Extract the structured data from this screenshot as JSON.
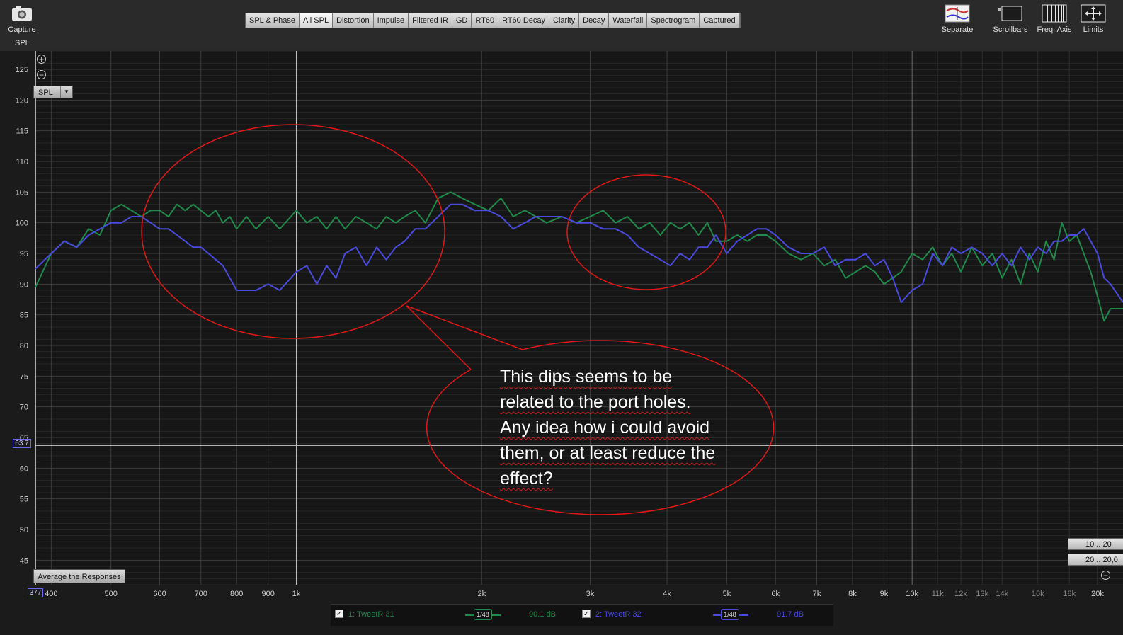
{
  "toolbar": {
    "capture_label": "Capture",
    "tabs": [
      "SPL & Phase",
      "All SPL",
      "Distortion",
      "Impulse",
      "Filtered IR",
      "GD",
      "RT60",
      "RT60 Decay",
      "Clarity",
      "Decay",
      "Waterfall",
      "Spectrogram",
      "Captured"
    ],
    "active_tab": "All SPL",
    "right_tools": [
      "Separate",
      "Scrollbars",
      "Freq. Axis",
      "Limits"
    ]
  },
  "plot": {
    "y_axis_title": "SPL",
    "selector_value": "SPL",
    "average_button_label": "Average the Responses",
    "range_buttons": [
      "10 .. 20",
      "20 .. 20,0"
    ],
    "cursor_y_value": "63.7",
    "cursor_x_value": "377"
  },
  "legend": {
    "trace1": {
      "label": "1: TweetR 31",
      "smoothing": "1/48",
      "level": "90.1 dB"
    },
    "trace2": {
      "label": "2: TweetR 32",
      "smoothing": "1/48",
      "level": "91.7 dB"
    }
  },
  "annotation": {
    "lines": [
      "This dips seems to be",
      "related to the port holes.",
      "Any idea how i could avoid",
      "them, or at least reduce the",
      "effect?"
    ]
  },
  "colors": {
    "trace1": "#1f8a4a",
    "trace2": "#4a4adf",
    "annotation": "#e01818",
    "background": "#1b1b1b"
  },
  "chart_data": {
    "type": "line",
    "title": "",
    "xlabel": "",
    "ylabel": "SPL",
    "x_scale": "log",
    "xlim": [
      377,
      22000
    ],
    "ylim": [
      41,
      128
    ],
    "grid": true,
    "y_ticks": [
      125,
      120,
      115,
      110,
      105,
      100,
      95,
      90,
      85,
      80,
      75,
      70,
      65,
      60,
      55,
      50,
      45
    ],
    "x_ticks": [
      {
        "f": 400,
        "label": "400",
        "major": true
      },
      {
        "f": 500,
        "label": "500",
        "major": true
      },
      {
        "f": 600,
        "label": "600",
        "major": true
      },
      {
        "f": 700,
        "label": "700",
        "major": true
      },
      {
        "f": 800,
        "label": "800",
        "major": true
      },
      {
        "f": 900,
        "label": "900",
        "major": true
      },
      {
        "f": 1000,
        "label": "1k",
        "major": true
      },
      {
        "f": 2000,
        "label": "2k",
        "major": true
      },
      {
        "f": 3000,
        "label": "3k",
        "major": true
      },
      {
        "f": 4000,
        "label": "4k",
        "major": true
      },
      {
        "f": 5000,
        "label": "5k",
        "major": true
      },
      {
        "f": 6000,
        "label": "6k",
        "major": true
      },
      {
        "f": 7000,
        "label": "7k",
        "major": true
      },
      {
        "f": 8000,
        "label": "8k",
        "major": true
      },
      {
        "f": 9000,
        "label": "9k",
        "major": true
      },
      {
        "f": 10000,
        "label": "10k",
        "major": true
      },
      {
        "f": 11000,
        "label": "11k",
        "major": false
      },
      {
        "f": 12000,
        "label": "12k",
        "major": false
      },
      {
        "f": 13000,
        "label": "13k",
        "major": false
      },
      {
        "f": 14000,
        "label": "14k",
        "major": false
      },
      {
        "f": 16000,
        "label": "16k",
        "major": false
      },
      {
        "f": 18000,
        "label": "18k",
        "major": false
      },
      {
        "f": 20000,
        "label": "20k",
        "major": true
      }
    ],
    "series": [
      {
        "name": "1: TweetR 31",
        "color": "#1f8a4a",
        "x": [
          377,
          400,
          420,
          440,
          460,
          480,
          500,
          520,
          540,
          560,
          580,
          600,
          620,
          640,
          660,
          680,
          700,
          720,
          740,
          760,
          780,
          800,
          830,
          860,
          900,
          940,
          980,
          1000,
          1040,
          1080,
          1120,
          1160,
          1200,
          1250,
          1300,
          1350,
          1400,
          1450,
          1500,
          1560,
          1620,
          1700,
          1780,
          1860,
          1950,
          2050,
          2150,
          2250,
          2350,
          2450,
          2550,
          2700,
          2850,
          3000,
          3150,
          3300,
          3450,
          3600,
          3750,
          3900,
          4050,
          4200,
          4350,
          4500,
          4650,
          4800,
          5000,
          5200,
          5400,
          5600,
          5800,
          6000,
          6300,
          6600,
          6900,
          7200,
          7500,
          7800,
          8100,
          8400,
          8700,
          9000,
          9300,
          9600,
          10000,
          10400,
          10800,
          11200,
          11600,
          12000,
          12500,
          13000,
          13500,
          14000,
          14500,
          15000,
          15500,
          16000,
          16500,
          17000,
          17500,
          18000,
          18500,
          19000,
          19500,
          20000,
          20500,
          21000,
          22000
        ],
        "y": [
          89.5,
          95,
          97,
          96,
          99,
          98,
          102,
          103,
          102,
          101,
          102,
          102,
          101,
          103,
          102,
          103,
          102,
          101,
          102,
          100,
          101,
          99,
          101,
          99,
          101,
          99,
          101,
          102,
          100,
          101,
          99,
          101,
          99,
          101,
          100,
          99,
          101,
          100,
          101,
          102,
          100,
          104,
          105,
          104,
          103,
          102,
          104,
          101,
          102,
          101,
          100,
          101,
          100,
          101,
          102,
          100,
          101,
          99,
          100,
          98,
          100,
          99,
          100,
          98,
          100,
          97,
          97,
          98,
          97,
          98,
          98,
          97,
          95,
          94,
          95,
          93,
          94,
          91,
          92,
          93,
          92,
          90,
          91,
          92,
          95,
          94,
          96,
          93,
          95,
          92,
          96,
          93,
          95,
          91,
          94,
          90,
          95,
          92,
          97,
          94,
          100,
          97,
          98,
          95,
          92,
          88,
          84,
          86,
          86
        ]
      },
      {
        "name": "2: TweetR 32",
        "color": "#4a4adf",
        "x": [
          377,
          400,
          420,
          440,
          460,
          480,
          500,
          520,
          540,
          560,
          580,
          600,
          620,
          640,
          660,
          680,
          700,
          720,
          740,
          760,
          780,
          800,
          830,
          860,
          900,
          940,
          980,
          1000,
          1040,
          1080,
          1120,
          1160,
          1200,
          1250,
          1300,
          1350,
          1400,
          1450,
          1500,
          1560,
          1620,
          1700,
          1780,
          1860,
          1950,
          2050,
          2150,
          2250,
          2350,
          2450,
          2550,
          2700,
          2850,
          3000,
          3150,
          3300,
          3450,
          3600,
          3750,
          3900,
          4050,
          4200,
          4350,
          4500,
          4650,
          4800,
          5000,
          5200,
          5400,
          5600,
          5800,
          6000,
          6300,
          6600,
          6900,
          7200,
          7500,
          7800,
          8100,
          8400,
          8700,
          9000,
          9300,
          9600,
          10000,
          10400,
          10800,
          11200,
          11600,
          12000,
          12500,
          13000,
          13500,
          14000,
          14500,
          15000,
          15500,
          16000,
          16500,
          17000,
          17500,
          18000,
          18500,
          19000,
          19500,
          20000,
          20500,
          21000,
          22000
        ],
        "y": [
          92.5,
          95,
          97,
          96,
          98,
          99,
          100,
          100,
          101,
          101,
          100,
          99,
          99,
          98,
          97,
          96,
          96,
          95,
          94,
          93,
          91,
          89,
          89,
          89,
          90,
          89,
          91,
          92,
          93,
          90,
          93,
          91,
          95,
          96,
          93,
          96,
          94,
          96,
          97,
          99,
          99,
          101,
          103,
          103,
          102,
          102,
          101,
          99,
          100,
          101,
          101,
          101,
          100,
          100,
          99,
          99,
          98,
          96,
          95,
          94,
          93,
          95,
          94,
          96,
          96,
          98,
          95,
          97,
          98,
          99,
          99,
          98,
          96,
          95,
          95,
          96,
          93,
          94,
          94,
          95,
          93,
          94,
          91,
          87,
          89,
          90,
          95,
          93,
          96,
          95,
          96,
          95,
          93,
          95,
          93,
          96,
          94,
          96,
          95,
          97,
          97,
          98,
          98,
          99,
          97,
          95,
          91,
          90,
          87
        ]
      }
    ]
  }
}
